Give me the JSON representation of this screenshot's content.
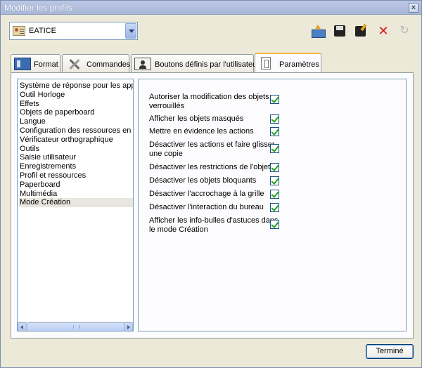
{
  "window": {
    "title": "Modifier les profils"
  },
  "profile": {
    "selected": "EATICE"
  },
  "toolbar": {
    "export_icon": "export-icon",
    "save_icon": "save-icon",
    "save_as_icon": "save-as-icon",
    "delete_icon": "delete-icon",
    "refresh_icon": "refresh-icon"
  },
  "tabs": [
    {
      "label": "Format",
      "icon": "format-icon",
      "active": false
    },
    {
      "label": "Commandes",
      "icon": "tools-icon",
      "active": false
    },
    {
      "label": "Boutons définis par l'utilisateur",
      "icon": "user-icon",
      "active": false
    },
    {
      "label": "Paramètres",
      "icon": "settings-icon",
      "active": true
    }
  ],
  "categories": [
    "Système de réponse pour les appren",
    "Outil Horloge",
    "Effets",
    "Objets de paperboard",
    "Langue",
    "Configuration des ressources en ligne",
    "Vérificateur orthographique",
    "Outils",
    "Saisie utilisateur",
    "Enregistrements",
    "Profil et ressources",
    "Paperboard",
    "Multimédia",
    "Mode Création"
  ],
  "selected_category": "Mode Création",
  "settings": [
    {
      "label": "Autoriser la modification des objets verrouillés",
      "checked": true
    },
    {
      "label": "Afficher les objets masqués",
      "checked": true
    },
    {
      "label": "Mettre en évidence les actions",
      "checked": true
    },
    {
      "label": "Désactiver les actions et faire glisser une copie",
      "checked": true
    },
    {
      "label": "Désactiver les restrictions de l'objet",
      "checked": true
    },
    {
      "label": "Désactiver les objets bloquants",
      "checked": true
    },
    {
      "label": "Désactiver l'accrochage à la grille",
      "checked": true
    },
    {
      "label": "Désactiver l'interaction du bureau",
      "checked": true
    },
    {
      "label": "Afficher les info-bulles d'astuces dans le mode Création",
      "checked": true
    }
  ],
  "buttons": {
    "done": "Terminé"
  },
  "colors": {
    "accent_tab": "#f5b642",
    "check": "#21a121",
    "delete": "#dd1111"
  }
}
